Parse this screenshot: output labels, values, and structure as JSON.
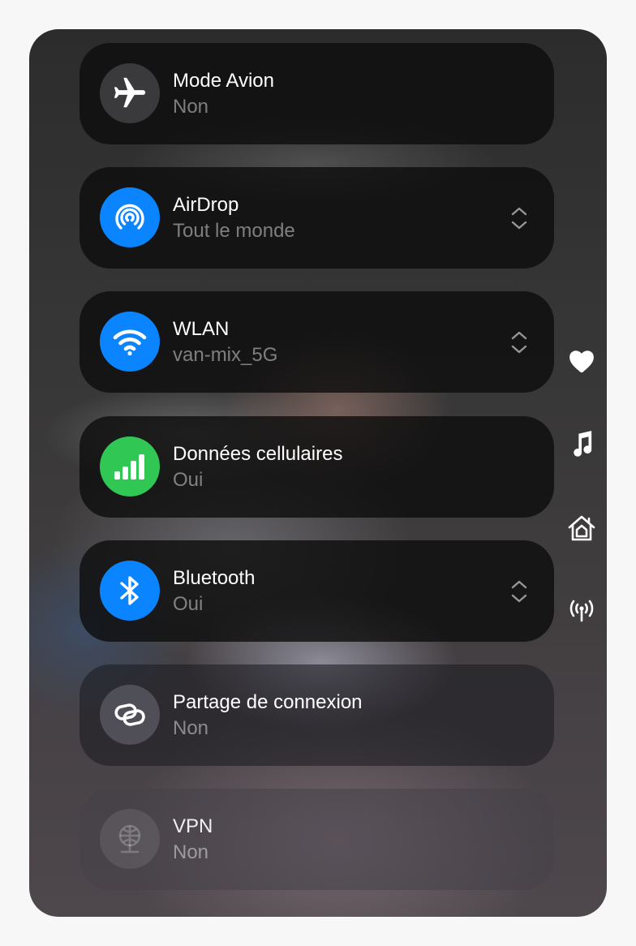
{
  "tiles": [
    {
      "title": "Mode Avion",
      "status": "Non",
      "icon": "airplane-icon"
    },
    {
      "title": "AirDrop",
      "status": "Tout le monde",
      "icon": "airdrop-icon",
      "color": "#0a84ff"
    },
    {
      "title": "WLAN",
      "status": "van-mix_5G",
      "icon": "wifi-icon",
      "color": "#0a84ff"
    },
    {
      "title": "Données cellulaires",
      "status": "Oui",
      "icon": "cellular-icon",
      "color": "#30c755"
    },
    {
      "title": "Bluetooth",
      "status": "Oui",
      "icon": "bluetooth-icon",
      "color": "#0a84ff"
    },
    {
      "title": "Partage de connexion",
      "status": "Non",
      "icon": "hotspot-link-icon"
    },
    {
      "title": "VPN",
      "status": "Non",
      "icon": "vpn-globe-icon"
    }
  ],
  "side_icons": [
    "heart-icon",
    "music-note-icon",
    "home-icon",
    "broadcast-icon"
  ]
}
